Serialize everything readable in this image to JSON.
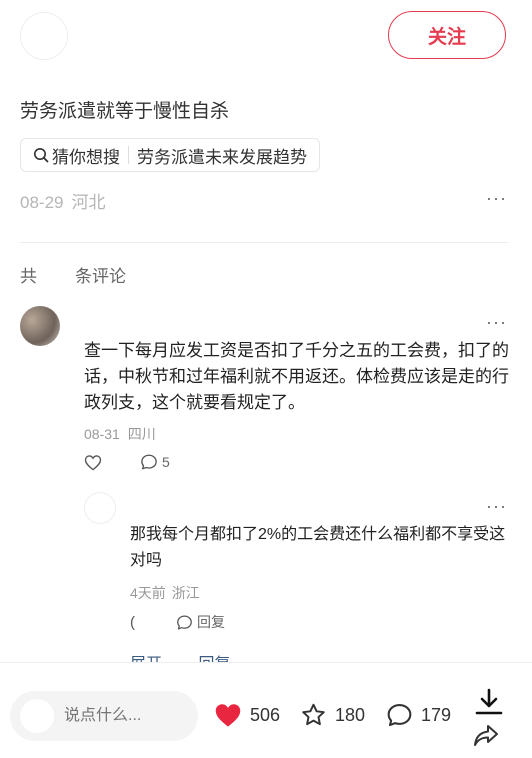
{
  "header": {
    "follow_label": "关注"
  },
  "post": {
    "title": "劳务派遣就等于慢性自杀",
    "search_chip": {
      "prefix": "猜你想搜",
      "query": "劳务派遣未来发展趋势"
    },
    "date": "08-29",
    "location": "河北",
    "more": "···"
  },
  "comments_section": {
    "count_prefix": "共",
    "count_suffix": "条评论"
  },
  "comment": {
    "text": "查一下每月应发工资是否扣了千分之五的工会费，扣了的话，中秋节和过年福利就不用返还。体检费应该是走的行政列支，这个就要看规定了。",
    "date": "08-31",
    "location": "四川",
    "reply_count": "5",
    "more": "···"
  },
  "reply": {
    "text": "那我每个月都扣了2%的工会费还什么福利都不享受这对吗",
    "time": "4天前",
    "location": "浙江",
    "like_partial": "(",
    "reply_label": "回复",
    "more": "···"
  },
  "partial_row": {
    "expand": "展开",
    "reply": "回复"
  },
  "bottom_bar": {
    "input_placeholder": "说点什么...",
    "likes": "506",
    "stars": "180",
    "comments": "179",
    "accent_color": "#e8263f"
  }
}
